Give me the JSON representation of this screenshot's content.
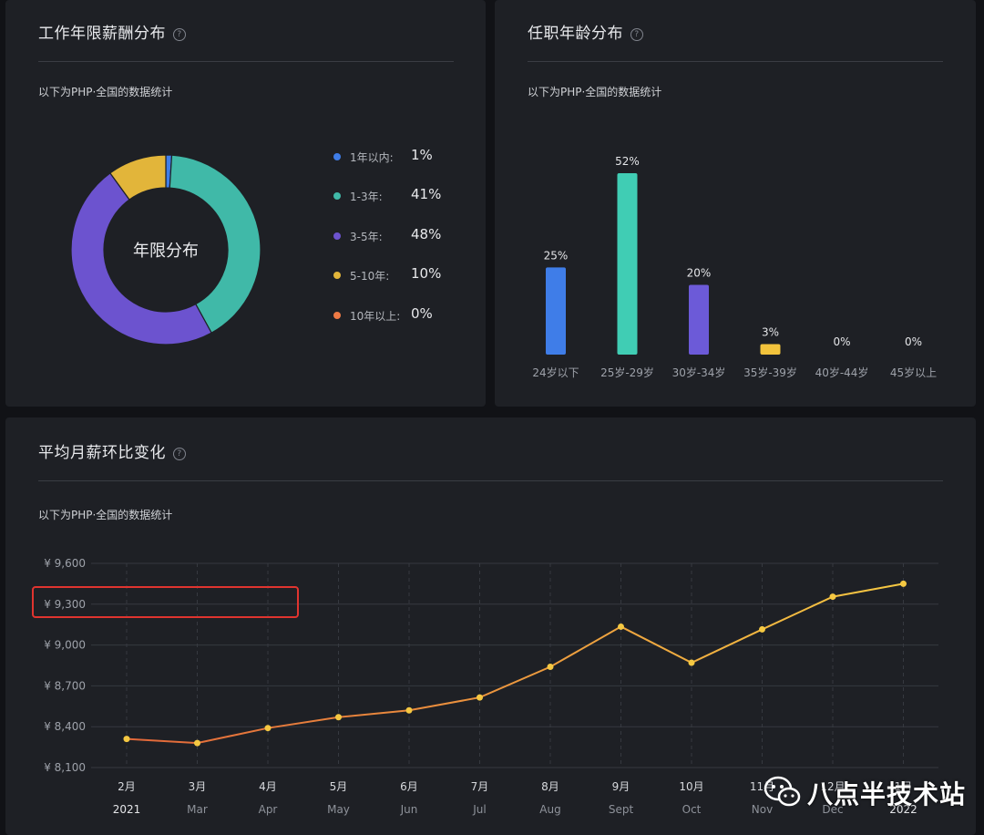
{
  "cards": {
    "experience": {
      "title": "工作年限薪酬分布",
      "subtitle": "以下为PHP·全国的数据统计",
      "center_label": "年限分布"
    },
    "age": {
      "title": "任职年龄分布",
      "subtitle": "以下为PHP·全国的数据统计"
    },
    "trend": {
      "title": "平均月薪环比变化",
      "subtitle": "以下为PHP·全国的数据统计"
    }
  },
  "help_icon_glyph": "?",
  "watermark": {
    "text": "八点半技术站",
    "icon": "wechat-icon"
  },
  "chart_data": [
    {
      "type": "pie",
      "donut": true,
      "categories": [
        "1年以内:",
        "1-3年:",
        "3-5年:",
        "5-10年:",
        "10年以上:"
      ],
      "values": [
        1,
        41,
        48,
        10,
        0
      ],
      "value_labels": [
        "1%",
        "41%",
        "48%",
        "10%",
        "0%"
      ],
      "colors": [
        "#3f7de8",
        "#40b9a8",
        "#6c53cf",
        "#e2b53a",
        "#ee7a45"
      ],
      "legend": "right"
    },
    {
      "type": "bar",
      "categories": [
        "24岁以下",
        "25岁-29岁",
        "30岁-34岁",
        "35岁-39岁",
        "40岁-44岁",
        "45岁以上"
      ],
      "values": [
        25,
        52,
        20,
        3,
        0,
        0
      ],
      "value_labels": [
        "25%",
        "52%",
        "20%",
        "3%",
        "0%",
        "0%"
      ],
      "colors": [
        "#3f7de8",
        "#40cdb4",
        "#6c5ad8",
        "#f2c33c",
        "#6c6f76",
        "#6c6f76"
      ]
    },
    {
      "type": "line",
      "x": [
        "2月",
        "3月",
        "4月",
        "5月",
        "6月",
        "7月",
        "8月",
        "9月",
        "10月",
        "11月",
        "12月",
        "1月"
      ],
      "x_sub": [
        "2021",
        "Mar",
        "Apr",
        "May",
        "Jun",
        "Jul",
        "Aug",
        "Sept",
        "Oct",
        "Nov",
        "Dec",
        "2022"
      ],
      "values": [
        8310,
        8280,
        8390,
        8470,
        8520,
        8615,
        8840,
        9135,
        8870,
        9115,
        9355,
        9450
      ],
      "y_ticks": [
        "¥ 9,600",
        "¥ 9,300",
        "¥ 9,000",
        "¥ 8,700",
        "¥ 8,400",
        "¥ 8,100"
      ],
      "ylim": [
        8100,
        9600
      ],
      "grid": true,
      "color_start": "#e2673a",
      "color_end": "#f5c842",
      "marker_color": "#f5c842"
    }
  ]
}
